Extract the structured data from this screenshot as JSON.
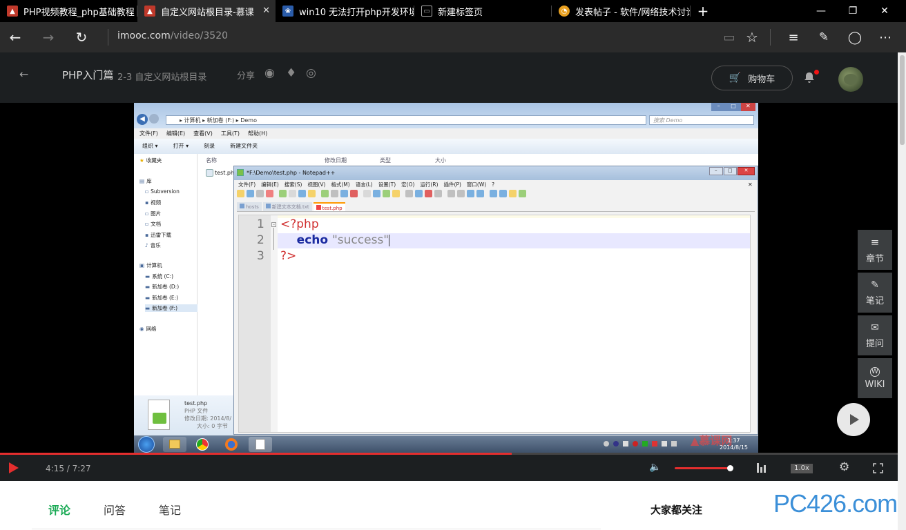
{
  "browser": {
    "tabs": [
      {
        "title": "PHP视频教程_php基础教程",
        "fav_color": "#c0392b",
        "fav_glyph": "▲"
      },
      {
        "title": "自定义网站根目录-慕课",
        "fav_color": "#c0392b",
        "fav_glyph": "▲"
      },
      {
        "title": "win10 无法打开php开发环境",
        "fav_color": "#2a5caa",
        "fav_glyph": "❀"
      },
      {
        "title": "新建标签页",
        "fav_color": "#444",
        "fav_glyph": "▭"
      },
      {
        "title": "发表帖子 - 软件/网络技术讨论",
        "fav_color": "#e8a020",
        "fav_glyph": "◔"
      }
    ],
    "active_tab": 1,
    "close_glyph": "✕",
    "new_tab_glyph": "+",
    "url_host": "imooc.com",
    "url_path": "/video/3520"
  },
  "site": {
    "back_glyph": "←",
    "course_name": "PHP入门篇",
    "lesson": "2-3 自定义网站根目录",
    "share_label": "分享",
    "cart_label": "购物车"
  },
  "player": {
    "time": "4:15 / 7:27",
    "progress": 0.57,
    "speed": "1.0x",
    "side": [
      {
        "label": "章节",
        "icon": "≡"
      },
      {
        "label": "笔记",
        "icon": "✎"
      },
      {
        "label": "提问",
        "icon": "✉"
      },
      {
        "label": "WIKI",
        "icon": "W"
      }
    ]
  },
  "explorer": {
    "breadcrumb": "▸ 计算机 ▸ 新加卷 (F:) ▸ Demo",
    "search_placeholder": "搜索 Demo",
    "menu": [
      "文件(F)",
      "编辑(E)",
      "查看(V)",
      "工具(T)",
      "帮助(H)"
    ],
    "toolbar": [
      "组织 ▾",
      "打开 ▾",
      "刻录",
      "新建文件夹"
    ],
    "columns": [
      "名称",
      "修改日期",
      "类型",
      "大小"
    ],
    "file": "test.php",
    "nav": [
      {
        "label": "收藏夹",
        "icon": "★"
      },
      {
        "label": "库",
        "icon": "▤"
      },
      {
        "label": "Subversion",
        "icon": "▫"
      },
      {
        "label": "视频",
        "icon": "▪"
      },
      {
        "label": "图片",
        "icon": "▫"
      },
      {
        "label": "文档",
        "icon": "▫"
      },
      {
        "label": "迅雷下载",
        "icon": "▪"
      },
      {
        "label": "音乐",
        "icon": "♪"
      },
      {
        "label": "计算机",
        "icon": "▣"
      },
      {
        "label": "系统 (C:)",
        "icon": "▬"
      },
      {
        "label": "新加卷 (D:)",
        "icon": "▬"
      },
      {
        "label": "新加卷 (E:)",
        "icon": "▬"
      },
      {
        "label": "新加卷 (F:)",
        "icon": "▬"
      },
      {
        "label": "网络",
        "icon": "◉"
      }
    ],
    "details": {
      "name": "test.php",
      "type": "PHP 文件",
      "modified": "修改日期: 2014/8/",
      "size": "大小: 0 字节"
    }
  },
  "notepad": {
    "title": "*F:\\Demo\\test.php - Notepad++",
    "menu": [
      "文件(F)",
      "编辑(E)",
      "搜索(S)",
      "视图(V)",
      "格式(M)",
      "语言(L)",
      "设置(T)",
      "宏(O)",
      "运行(R)",
      "插件(P)",
      "窗口(W)",
      "?"
    ],
    "tabs": [
      "hosts",
      "新建文本文档.txt",
      "test.php"
    ],
    "lines": [
      {
        "num": "1",
        "parts": [
          {
            "t": "<?php",
            "c": "#d03030"
          }
        ]
      },
      {
        "num": "2",
        "parts": [
          {
            "t": "    echo ",
            "c": "#1a2aa0",
            "b": true
          },
          {
            "t": "\"success\"",
            "c": "#888888"
          }
        ]
      },
      {
        "num": "3",
        "parts": [
          {
            "t": "?>",
            "c": "#d03030"
          }
        ]
      }
    ]
  },
  "taskbar": {
    "clock": "1:37",
    "date": "2014/8/15"
  },
  "below": {
    "tabs": [
      "评论",
      "问答",
      "笔记"
    ],
    "follow": "大家都关注",
    "watermark": "PC426.com"
  }
}
